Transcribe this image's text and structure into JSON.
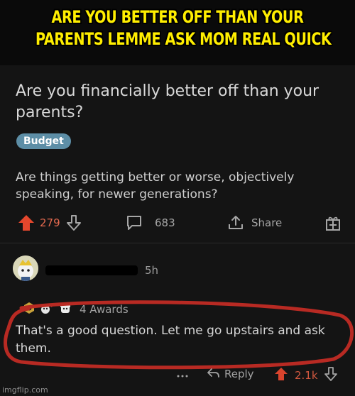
{
  "caption": {
    "line1": "ARE YOU BETTER OFF THAN YOUR",
    "line2": "PARENTS LEMME ASK MOM REAL QUICK"
  },
  "post": {
    "title": "Are you financially better off than your parents?",
    "flair": "Budget",
    "body": "Are things getting better or worse, objectively speaking, for newer generations?",
    "upvotes": "279",
    "comments": "683",
    "share_label": "Share"
  },
  "comment": {
    "time": "5h",
    "awards_label": "4 Awards",
    "text": "That's a good question. Let me go upstairs and ask them.",
    "reply_label": "Reply",
    "votes": "2.1k"
  },
  "watermark": "imgflip.com",
  "colors": {
    "caption": "#ffee00",
    "upvote": "#e46a4f",
    "flair": "#5d8ea6",
    "circle": "#b82a23"
  }
}
